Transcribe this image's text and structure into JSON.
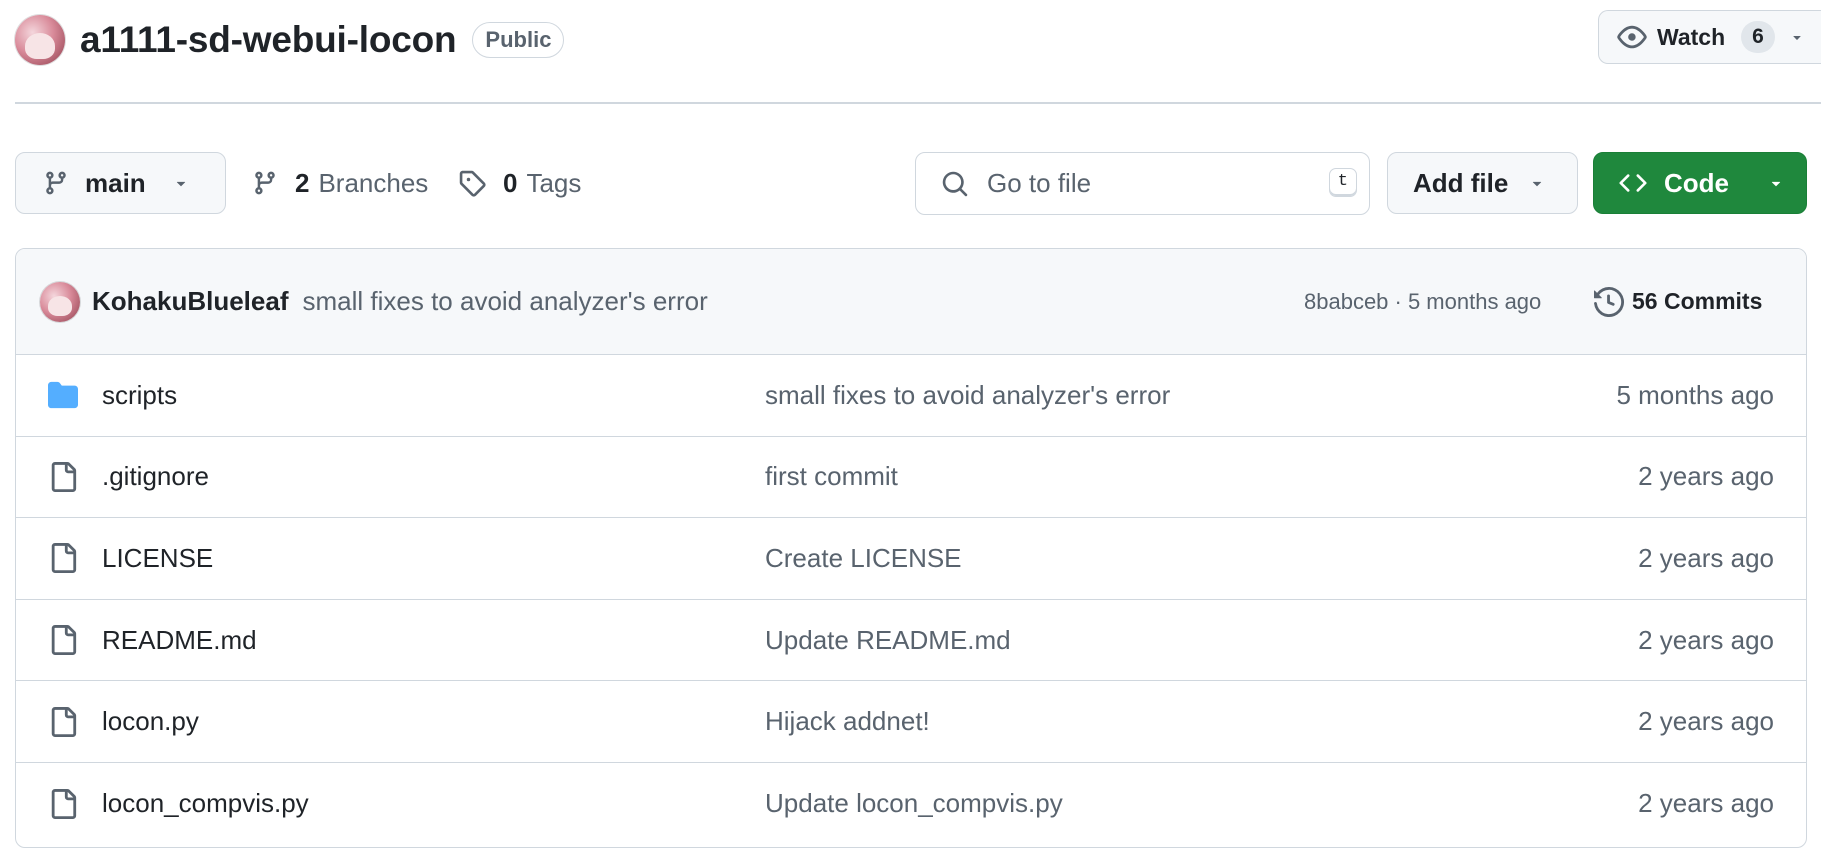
{
  "repo": {
    "name": "a1111-sd-webui-locon",
    "visibility": "Public"
  },
  "watch": {
    "label": "Watch",
    "count": "6"
  },
  "toolbar": {
    "branch": "main",
    "branches_count": "2",
    "branches_label": "Branches",
    "tags_count": "0",
    "tags_label": "Tags",
    "search_placeholder": "Go to file",
    "search_shortcut": "t",
    "add_file_label": "Add file",
    "code_label": "Code"
  },
  "latest_commit": {
    "author": "KohakuBlueleaf",
    "message": "small fixes to avoid analyzer's error",
    "meta": "8babceb · 5 months ago",
    "commits_label": "56 Commits"
  },
  "files": [
    {
      "name": "scripts",
      "type": "folder",
      "commit": "small fixes to avoid analyzer's error",
      "date": "5 months ago"
    },
    {
      "name": ".gitignore",
      "type": "file",
      "commit": "first commit",
      "date": "2 years ago"
    },
    {
      "name": "LICENSE",
      "type": "file",
      "commit": "Create LICENSE",
      "date": "2 years ago"
    },
    {
      "name": "README.md",
      "type": "file",
      "commit": "Update README.md",
      "date": "2 years ago"
    },
    {
      "name": "locon.py",
      "type": "file",
      "commit": "Hijack addnet!",
      "date": "2 years ago"
    },
    {
      "name": "locon_compvis.py",
      "type": "file",
      "commit": "Update locon_compvis.py",
      "date": "2 years ago"
    }
  ],
  "colors": {
    "primary_green": "#1f883d",
    "border": "#d0d7de",
    "muted_text": "#59636e",
    "folder_blue": "#54aeff"
  }
}
